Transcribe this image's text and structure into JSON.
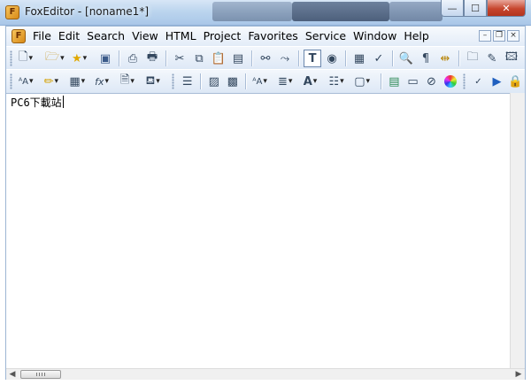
{
  "window": {
    "title": "FoxEditor - [noname1*]",
    "icon": "foxeditor-app-icon",
    "controls": {
      "minimize": "—",
      "maximize": "☐",
      "close": "✕"
    }
  },
  "menubar": {
    "items": [
      "File",
      "Edit",
      "Search",
      "View",
      "HTML",
      "Project",
      "Favorites",
      "Service",
      "Window",
      "Help"
    ],
    "mdi_controls": {
      "minimize": "–",
      "restore": "❐",
      "close": "×"
    }
  },
  "toolbar1": {
    "buttons": [
      "new-document",
      "open-folder",
      "favorites-star",
      "save",
      "print-preview",
      "print",
      "cut",
      "copy",
      "paste",
      "paste-special",
      "find",
      "find-next",
      "text-mode",
      "browser-preview",
      "properties",
      "spell-check",
      "zoom",
      "paragraph-mark",
      "bookmark",
      "folder",
      "edit-page",
      "image-insert"
    ]
  },
  "toolbar2": {
    "buttons": [
      "font-style",
      "highlight-color",
      "table",
      "function",
      "document",
      "paint-bucket",
      "align",
      "insert-image",
      "insert-media",
      "font-size",
      "line-spacing",
      "text-color",
      "bulleted-list",
      "border",
      "page-break",
      "horizontal-rule",
      "link",
      "color-wheel",
      "spell-check-abc",
      "play",
      "lock"
    ]
  },
  "editor": {
    "text": "PC6下載站"
  }
}
